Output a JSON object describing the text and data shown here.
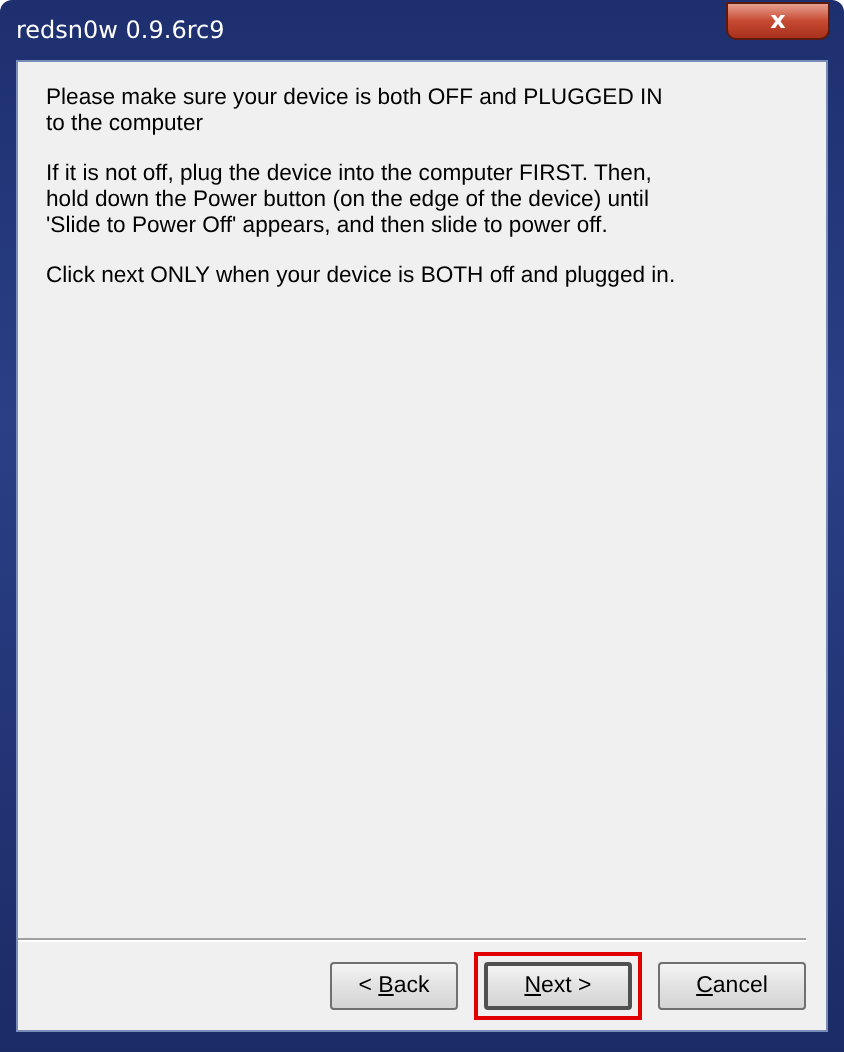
{
  "window": {
    "title": "redsn0w 0.9.6rc9",
    "close_label": "x"
  },
  "paragraphs": [
    "Please make sure your device is both OFF and PLUGGED IN to the computer",
    "If it is not off, plug the device into the computer FIRST. Then, hold down the Power button (on the edge of the device) until 'Slide to Power Off' appears, and then slide to power off.",
    "Click next ONLY when your device is BOTH off and plugged in."
  ],
  "buttons": [
    {
      "before": "< ",
      "key": "B",
      "after": "ack",
      "default": false,
      "highlighted": false
    },
    {
      "key": "N",
      "after": "ext >",
      "default": true,
      "highlighted": true
    },
    {
      "key": "C",
      "after": "ancel",
      "default": false,
      "highlighted": false
    }
  ]
}
